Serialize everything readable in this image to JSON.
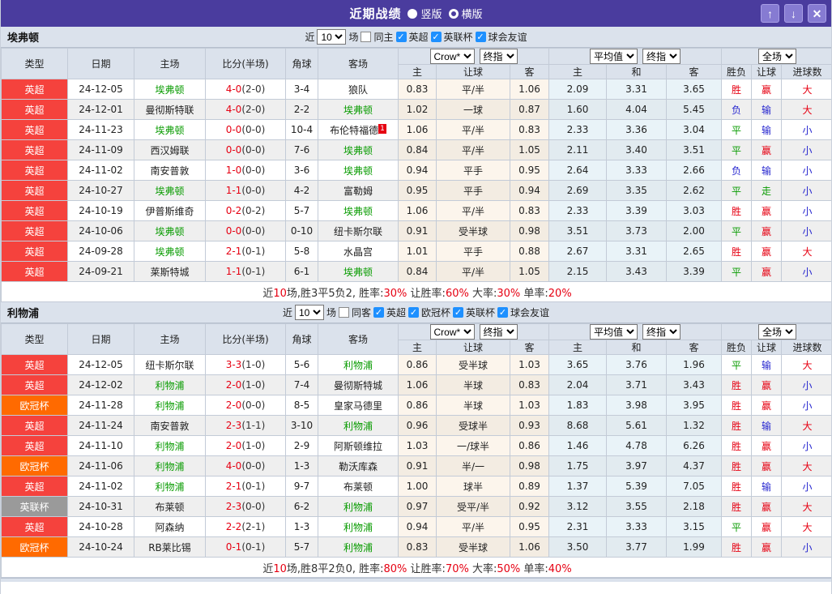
{
  "titlebar": {
    "title": "近期战绩",
    "radios": [
      {
        "label": "竖版",
        "selected": false
      },
      {
        "label": "横版",
        "selected": true
      }
    ],
    "icons": {
      "up_arrow": "↑",
      "down_arrow": "↓",
      "close": "✕"
    }
  },
  "colors": {
    "accent_purple": "#4a3c9e",
    "league": {
      "英超": "#f5423d",
      "欧冠杯": "#ff6a00",
      "英联杯": "#9a9a9a"
    },
    "win_red": "#e60012",
    "draw_green": "#089b00",
    "lose_blue": "#2626cf"
  },
  "columns": {
    "main": [
      "类型",
      "日期",
      "主场",
      "比分(半场)",
      "角球",
      "客场"
    ],
    "sub": [
      "主",
      "让球",
      "客",
      "主",
      "和",
      "客",
      "胜负",
      "让球",
      "进球数"
    ],
    "selects": {
      "provider": "Crow*",
      "provider_stage": "终指",
      "average": "平均值",
      "average_stage": "终指",
      "scope": "全场"
    }
  },
  "sections": [
    {
      "team": "埃弗顿",
      "filter": {
        "prefix": "近",
        "count": "10",
        "suffix": "场",
        "same_label": "同主",
        "same_checked": false,
        "leagues": [
          {
            "label": "英超",
            "checked": true
          },
          {
            "label": "英联杯",
            "checked": true
          },
          {
            "label": "球会友谊",
            "checked": true
          }
        ]
      },
      "rows": [
        {
          "league": "英超",
          "date": "24-12-05",
          "home": "埃弗顿",
          "hf": true,
          "ft": "4-0",
          "ht": "(2-0)",
          "corner": "3-4",
          "away": "狼队",
          "af": false,
          "ah": [
            "0.83",
            "平/半",
            "1.06"
          ],
          "eu": [
            "2.09",
            "3.31",
            "3.65"
          ],
          "res": {
            "t": "胜",
            "c": "r"
          },
          "hres": {
            "t": "赢",
            "c": "r"
          },
          "gres": {
            "t": "大",
            "c": "r"
          }
        },
        {
          "league": "英超",
          "date": "24-12-01",
          "home": "曼彻斯特联",
          "hf": false,
          "ft": "4-0",
          "ht": "(2-0)",
          "corner": "2-2",
          "away": "埃弗顿",
          "af": true,
          "ah": [
            "1.02",
            "一球",
            "0.87"
          ],
          "eu": [
            "1.60",
            "4.04",
            "5.45"
          ],
          "res": {
            "t": "负",
            "c": "b"
          },
          "hres": {
            "t": "输",
            "c": "b"
          },
          "gres": {
            "t": "大",
            "c": "r"
          }
        },
        {
          "league": "英超",
          "date": "24-11-23",
          "home": "埃弗顿",
          "hf": true,
          "ft": "0-0",
          "ht": "(0-0)",
          "corner": "10-4",
          "away": "布伦特福德",
          "af": false,
          "away_badge": "1",
          "ah": [
            "1.06",
            "平/半",
            "0.83"
          ],
          "eu": [
            "2.33",
            "3.36",
            "3.04"
          ],
          "res": {
            "t": "平",
            "c": "g"
          },
          "hres": {
            "t": "输",
            "c": "b"
          },
          "gres": {
            "t": "小",
            "c": "b"
          }
        },
        {
          "league": "英超",
          "date": "24-11-09",
          "home": "西汉姆联",
          "hf": false,
          "ft": "0-0",
          "ht": "(0-0)",
          "corner": "7-6",
          "away": "埃弗顿",
          "af": true,
          "ah": [
            "0.84",
            "平/半",
            "1.05"
          ],
          "eu": [
            "2.11",
            "3.40",
            "3.51"
          ],
          "res": {
            "t": "平",
            "c": "g"
          },
          "hres": {
            "t": "赢",
            "c": "r"
          },
          "gres": {
            "t": "小",
            "c": "b"
          }
        },
        {
          "league": "英超",
          "date": "24-11-02",
          "home": "南安普敦",
          "hf": false,
          "ft": "1-0",
          "ht": "(0-0)",
          "corner": "3-6",
          "away": "埃弗顿",
          "af": true,
          "ah": [
            "0.94",
            "平手",
            "0.95"
          ],
          "eu": [
            "2.64",
            "3.33",
            "2.66"
          ],
          "res": {
            "t": "负",
            "c": "b"
          },
          "hres": {
            "t": "输",
            "c": "b"
          },
          "gres": {
            "t": "小",
            "c": "b"
          }
        },
        {
          "league": "英超",
          "date": "24-10-27",
          "home": "埃弗顿",
          "hf": true,
          "ft": "1-1",
          "ht": "(0-0)",
          "corner": "4-2",
          "away": "富勒姆",
          "af": false,
          "ah": [
            "0.95",
            "平手",
            "0.94"
          ],
          "eu": [
            "2.69",
            "3.35",
            "2.62"
          ],
          "res": {
            "t": "平",
            "c": "g"
          },
          "hres": {
            "t": "走",
            "c": "g"
          },
          "gres": {
            "t": "小",
            "c": "b"
          }
        },
        {
          "league": "英超",
          "date": "24-10-19",
          "home": "伊普斯维奇",
          "hf": false,
          "ft": "0-2",
          "ht": "(0-2)",
          "corner": "5-7",
          "away": "埃弗顿",
          "af": true,
          "ah": [
            "1.06",
            "平/半",
            "0.83"
          ],
          "eu": [
            "2.33",
            "3.39",
            "3.03"
          ],
          "res": {
            "t": "胜",
            "c": "r"
          },
          "hres": {
            "t": "赢",
            "c": "r"
          },
          "gres": {
            "t": "小",
            "c": "b"
          }
        },
        {
          "league": "英超",
          "date": "24-10-06",
          "home": "埃弗顿",
          "hf": true,
          "ft": "0-0",
          "ht": "(0-0)",
          "corner": "0-10",
          "away": "纽卡斯尔联",
          "af": false,
          "ah": [
            "0.91",
            "受半球",
            "0.98"
          ],
          "eu": [
            "3.51",
            "3.73",
            "2.00"
          ],
          "res": {
            "t": "平",
            "c": "g"
          },
          "hres": {
            "t": "赢",
            "c": "r"
          },
          "gres": {
            "t": "小",
            "c": "b"
          }
        },
        {
          "league": "英超",
          "date": "24-09-28",
          "home": "埃弗顿",
          "hf": true,
          "ft": "2-1",
          "ht": "(0-1)",
          "corner": "5-8",
          "away": "水晶宫",
          "af": false,
          "ah": [
            "1.01",
            "平手",
            "0.88"
          ],
          "eu": [
            "2.67",
            "3.31",
            "2.65"
          ],
          "res": {
            "t": "胜",
            "c": "r"
          },
          "hres": {
            "t": "赢",
            "c": "r"
          },
          "gres": {
            "t": "大",
            "c": "r"
          }
        },
        {
          "league": "英超",
          "date": "24-09-21",
          "home": "莱斯特城",
          "hf": false,
          "ft": "1-1",
          "ht": "(0-1)",
          "corner": "6-1",
          "away": "埃弗顿",
          "af": true,
          "ah": [
            "0.84",
            "平/半",
            "1.05"
          ],
          "eu": [
            "2.15",
            "3.43",
            "3.39"
          ],
          "res": {
            "t": "平",
            "c": "g"
          },
          "hres": {
            "t": "赢",
            "c": "r"
          },
          "gres": {
            "t": "小",
            "c": "b"
          }
        }
      ],
      "summary": [
        {
          "t": "近",
          "c": "d"
        },
        {
          "t": "10",
          "c": "r"
        },
        {
          "t": "场,胜3平5负2, 胜率:",
          "c": "d"
        },
        {
          "t": "30%",
          "c": "r"
        },
        {
          "t": " 让胜率:",
          "c": "d"
        },
        {
          "t": "60%",
          "c": "r"
        },
        {
          "t": " 大率:",
          "c": "d"
        },
        {
          "t": "30%",
          "c": "r"
        },
        {
          "t": " 单率:",
          "c": "d"
        },
        {
          "t": "20%",
          "c": "r"
        }
      ]
    },
    {
      "team": "利物浦",
      "filter": {
        "prefix": "近",
        "count": "10",
        "suffix": "场",
        "same_label": "同客",
        "same_checked": false,
        "leagues": [
          {
            "label": "英超",
            "checked": true
          },
          {
            "label": "欧冠杯",
            "checked": true
          },
          {
            "label": "英联杯",
            "checked": true
          },
          {
            "label": "球会友谊",
            "checked": true
          }
        ]
      },
      "rows": [
        {
          "league": "英超",
          "date": "24-12-05",
          "home": "纽卡斯尔联",
          "hf": false,
          "ft": "3-3",
          "ht": "(1-0)",
          "corner": "5-6",
          "away": "利物浦",
          "af": true,
          "ah": [
            "0.86",
            "受半球",
            "1.03"
          ],
          "eu": [
            "3.65",
            "3.76",
            "1.96"
          ],
          "res": {
            "t": "平",
            "c": "g"
          },
          "hres": {
            "t": "输",
            "c": "b"
          },
          "gres": {
            "t": "大",
            "c": "r"
          }
        },
        {
          "league": "英超",
          "date": "24-12-02",
          "home": "利物浦",
          "hf": true,
          "ft": "2-0",
          "ht": "(1-0)",
          "corner": "7-4",
          "away": "曼彻斯特城",
          "af": false,
          "ah": [
            "1.06",
            "半球",
            "0.83"
          ],
          "eu": [
            "2.04",
            "3.71",
            "3.43"
          ],
          "res": {
            "t": "胜",
            "c": "r"
          },
          "hres": {
            "t": "赢",
            "c": "r"
          },
          "gres": {
            "t": "小",
            "c": "b"
          }
        },
        {
          "league": "欧冠杯",
          "date": "24-11-28",
          "home": "利物浦",
          "hf": true,
          "ft": "2-0",
          "ht": "(0-0)",
          "corner": "8-5",
          "away": "皇家马德里",
          "af": false,
          "ah": [
            "0.86",
            "半球",
            "1.03"
          ],
          "eu": [
            "1.83",
            "3.98",
            "3.95"
          ],
          "res": {
            "t": "胜",
            "c": "r"
          },
          "hres": {
            "t": "赢",
            "c": "r"
          },
          "gres": {
            "t": "小",
            "c": "b"
          }
        },
        {
          "league": "英超",
          "date": "24-11-24",
          "home": "南安普敦",
          "hf": false,
          "ft": "2-3",
          "ht": "(1-1)",
          "corner": "3-10",
          "away": "利物浦",
          "af": true,
          "ah": [
            "0.96",
            "受球半",
            "0.93"
          ],
          "eu": [
            "8.68",
            "5.61",
            "1.32"
          ],
          "res": {
            "t": "胜",
            "c": "r"
          },
          "hres": {
            "t": "输",
            "c": "b"
          },
          "gres": {
            "t": "大",
            "c": "r"
          }
        },
        {
          "league": "英超",
          "date": "24-11-10",
          "home": "利物浦",
          "hf": true,
          "ft": "2-0",
          "ht": "(1-0)",
          "corner": "2-9",
          "away": "阿斯顿维拉",
          "af": false,
          "ah": [
            "1.03",
            "一/球半",
            "0.86"
          ],
          "eu": [
            "1.46",
            "4.78",
            "6.26"
          ],
          "res": {
            "t": "胜",
            "c": "r"
          },
          "hres": {
            "t": "赢",
            "c": "r"
          },
          "gres": {
            "t": "小",
            "c": "b"
          }
        },
        {
          "league": "欧冠杯",
          "date": "24-11-06",
          "home": "利物浦",
          "hf": true,
          "ft": "4-0",
          "ht": "(0-0)",
          "corner": "1-3",
          "away": "勒沃库森",
          "af": false,
          "ah": [
            "0.91",
            "半/一",
            "0.98"
          ],
          "eu": [
            "1.75",
            "3.97",
            "4.37"
          ],
          "res": {
            "t": "胜",
            "c": "r"
          },
          "hres": {
            "t": "赢",
            "c": "r"
          },
          "gres": {
            "t": "大",
            "c": "r"
          }
        },
        {
          "league": "英超",
          "date": "24-11-02",
          "home": "利物浦",
          "hf": true,
          "ft": "2-1",
          "ht": "(0-1)",
          "corner": "9-7",
          "away": "布莱顿",
          "af": false,
          "ah": [
            "1.00",
            "球半",
            "0.89"
          ],
          "eu": [
            "1.37",
            "5.39",
            "7.05"
          ],
          "res": {
            "t": "胜",
            "c": "r"
          },
          "hres": {
            "t": "输",
            "c": "b"
          },
          "gres": {
            "t": "小",
            "c": "b"
          }
        },
        {
          "league": "英联杯",
          "date": "24-10-31",
          "home": "布莱顿",
          "hf": false,
          "ft": "2-3",
          "ht": "(0-0)",
          "corner": "6-2",
          "away": "利物浦",
          "af": true,
          "ah": [
            "0.97",
            "受平/半",
            "0.92"
          ],
          "eu": [
            "3.12",
            "3.55",
            "2.18"
          ],
          "res": {
            "t": "胜",
            "c": "r"
          },
          "hres": {
            "t": "赢",
            "c": "r"
          },
          "gres": {
            "t": "大",
            "c": "r"
          }
        },
        {
          "league": "英超",
          "date": "24-10-28",
          "home": "阿森纳",
          "hf": false,
          "ft": "2-2",
          "ht": "(2-1)",
          "corner": "1-3",
          "away": "利物浦",
          "af": true,
          "ah": [
            "0.94",
            "平/半",
            "0.95"
          ],
          "eu": [
            "2.31",
            "3.33",
            "3.15"
          ],
          "res": {
            "t": "平",
            "c": "g"
          },
          "hres": {
            "t": "赢",
            "c": "r"
          },
          "gres": {
            "t": "大",
            "c": "r"
          }
        },
        {
          "league": "欧冠杯",
          "date": "24-10-24",
          "home": "RB莱比锡",
          "hf": false,
          "ft": "0-1",
          "ht": "(0-1)",
          "corner": "5-7",
          "away": "利物浦",
          "af": true,
          "ah": [
            "0.83",
            "受半球",
            "1.06"
          ],
          "eu": [
            "3.50",
            "3.77",
            "1.99"
          ],
          "res": {
            "t": "胜",
            "c": "r"
          },
          "hres": {
            "t": "赢",
            "c": "r"
          },
          "gres": {
            "t": "小",
            "c": "b"
          }
        }
      ],
      "summary": [
        {
          "t": "近",
          "c": "d"
        },
        {
          "t": "10",
          "c": "r"
        },
        {
          "t": "场,胜8平2负0, 胜率:",
          "c": "d"
        },
        {
          "t": "80%",
          "c": "r"
        },
        {
          "t": " 让胜率:",
          "c": "d"
        },
        {
          "t": "70%",
          "c": "r"
        },
        {
          "t": " 大率:",
          "c": "d"
        },
        {
          "t": "50%",
          "c": "r"
        },
        {
          "t": " 单率:",
          "c": "d"
        },
        {
          "t": "40%",
          "c": "r"
        }
      ]
    }
  ]
}
